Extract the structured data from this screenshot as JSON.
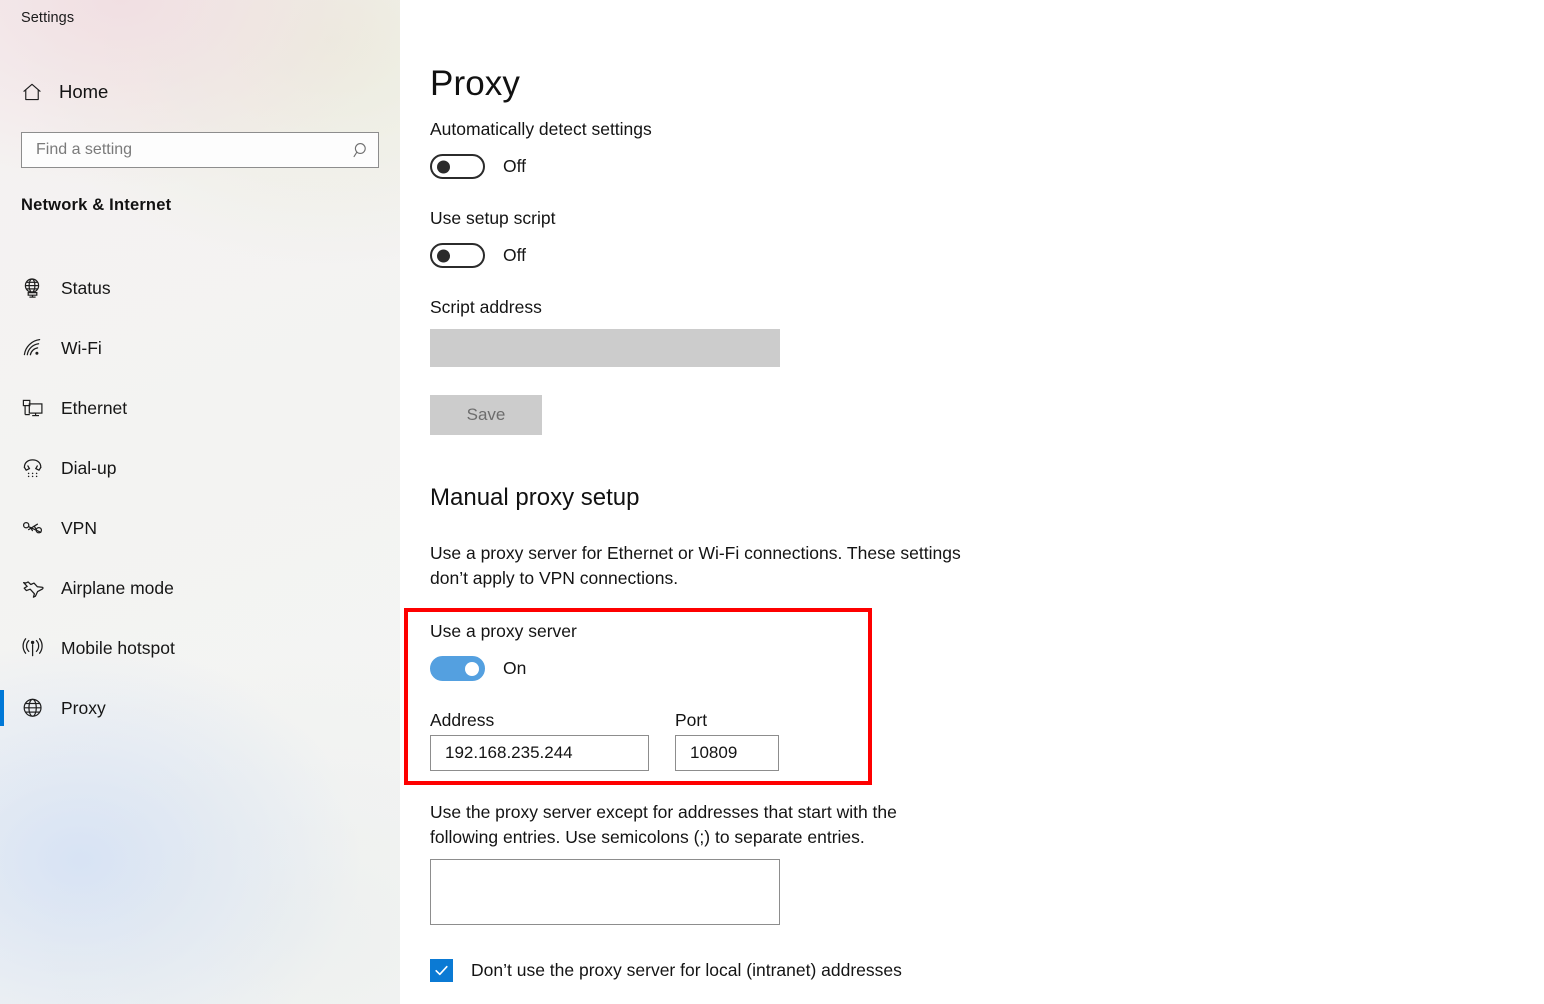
{
  "window": {
    "title": "Settings"
  },
  "sidebar": {
    "home_label": "Home",
    "home_icon": "home-icon",
    "search": {
      "placeholder": "Find a setting",
      "value": "",
      "icon": "search-icon"
    },
    "group_title": "Network & Internet",
    "items": [
      {
        "label": "Status",
        "icon": "globe-monitor-icon",
        "selected": false
      },
      {
        "label": "Wi-Fi",
        "icon": "wifi-icon",
        "selected": false
      },
      {
        "label": "Ethernet",
        "icon": "ethernet-icon",
        "selected": false
      },
      {
        "label": "Dial-up",
        "icon": "dialup-phone-icon",
        "selected": false
      },
      {
        "label": "VPN",
        "icon": "vpn-key-icon",
        "selected": false
      },
      {
        "label": "Airplane mode",
        "icon": "airplane-icon",
        "selected": false
      },
      {
        "label": "Mobile hotspot",
        "icon": "hotspot-icon",
        "selected": false
      },
      {
        "label": "Proxy",
        "icon": "globe-icon",
        "selected": true
      }
    ]
  },
  "main": {
    "page_title": "Proxy",
    "auto_detect": {
      "label": "Automatically detect settings",
      "state": "Off",
      "on": false
    },
    "setup_script": {
      "label": "Use setup script",
      "state": "Off",
      "on": false
    },
    "script_address": {
      "label": "Script address",
      "value": "",
      "disabled": true
    },
    "save_button": {
      "label": "Save",
      "disabled": true
    },
    "manual_setup": {
      "heading": "Manual proxy setup",
      "description_line1": "Use a proxy server for Ethernet or Wi-Fi connections. These settings",
      "description_line2": "don’t apply to VPN connections.",
      "use_proxy": {
        "label": "Use a proxy server",
        "state": "On",
        "on": true
      },
      "address": {
        "label": "Address",
        "value": "192.168.235.244"
      },
      "port": {
        "label": "Port",
        "value": "10809"
      },
      "exceptions": {
        "description_line1": "Use the proxy server except for addresses that start with the",
        "description_line2": "following entries. Use semicolons (;) to separate entries.",
        "value": ""
      },
      "bypass_local": {
        "label": "Don’t use the proxy server for local (intranet) addresses",
        "checked": true
      }
    }
  },
  "colors": {
    "accent": "#0078d7",
    "toggle_on": "#54a0e0",
    "checkbox": "#0b7ad4",
    "highlight_box": "#fe0000",
    "disabled_field": "#cccccc"
  }
}
